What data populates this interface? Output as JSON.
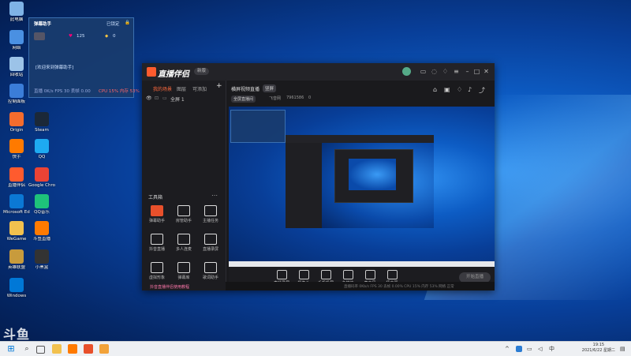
{
  "desktop": {
    "icons": [
      {
        "label": "此电脑",
        "color": "#7fb3e6"
      },
      {
        "label": "网络",
        "color": "#4a90e2"
      },
      {
        "label": "回收站",
        "color": "#9cc3e8"
      },
      {
        "label": "控制面板",
        "color": "#3b7dd8"
      },
      {
        "label": "Origin",
        "color": "#f56c2d"
      },
      {
        "label": "Steam",
        "color": "#1b2838"
      },
      {
        "label": "快手",
        "color": "#ff7a00"
      },
      {
        "label": "QQ",
        "color": "#1eaaf1"
      },
      {
        "label": "直播伴侣",
        "color": "#ff5b2e"
      },
      {
        "label": "Google Chrome",
        "color": "#ea4335"
      },
      {
        "label": "Microsoft Edge",
        "color": "#0b78d4"
      },
      {
        "label": "QQ音乐",
        "color": "#1ec27a"
      },
      {
        "label": "WeGame",
        "color": "#f2c14e"
      },
      {
        "label": "斗鱼直播",
        "color": "#ff7a00"
      },
      {
        "label": "英雄联盟",
        "color": "#c89b3c"
      },
      {
        "label": "小黑盒",
        "color": "#333"
      },
      {
        "label": "Windows",
        "color": "#0078d7"
      }
    ]
  },
  "overlay": {
    "title": "弹幕助手",
    "status": "已锁定",
    "likes": "125",
    "gifts": "0",
    "message": "[欢迎来到弹幕助手]",
    "stats": "直播 0K/s  FPS 30  丢帧 0.00",
    "cpu": "CPU 15%  内存 53%"
  },
  "window": {
    "app_name": "直播伴侣",
    "version_pill": "新版",
    "sidebar_tabs": [
      "我的场景",
      "图层",
      "可添加"
    ],
    "scene_label": "全屏 1",
    "tools_heading": "工具箱",
    "tools": [
      {
        "label": "弹幕助手",
        "color": "#e8502b"
      },
      {
        "label": "房管助手",
        "color": "#ddd"
      },
      {
        "label": "主播任务",
        "color": "#ddd"
      },
      {
        "label": "抖音直播",
        "color": "#ddd"
      },
      {
        "label": "多人连麦",
        "color": "#ddd"
      },
      {
        "label": "直播录屏",
        "color": "#ddd"
      },
      {
        "label": "虚拟形象",
        "color": "#ddd"
      },
      {
        "label": "弹幕库",
        "color": "#ddd"
      },
      {
        "label": "歌词助手",
        "color": "#ddd"
      }
    ],
    "sidebar_footer": "抖音直播伴侣使用教程",
    "content_tabs": [
      "横屏视频直播",
      "竖屏"
    ],
    "live_title": "全屏直播间",
    "fans_label": "飞音网",
    "fans_count": "7961586",
    "live_count": "0",
    "bottom_buttons": [
      "直播录屏",
      "摄像头",
      "手机投屏",
      "多媒体",
      "麦克风",
      "扬声器"
    ],
    "live_button": "开始直播",
    "statusbar": "直播码率 0Kb/s  FPS 30  丢帧 0.00%  CPU 15%  内存 53%  网络 正常"
  },
  "taskbar": {
    "time": "19:15",
    "date": "2021/6/22 星期二"
  },
  "watermark": "斗鱼"
}
